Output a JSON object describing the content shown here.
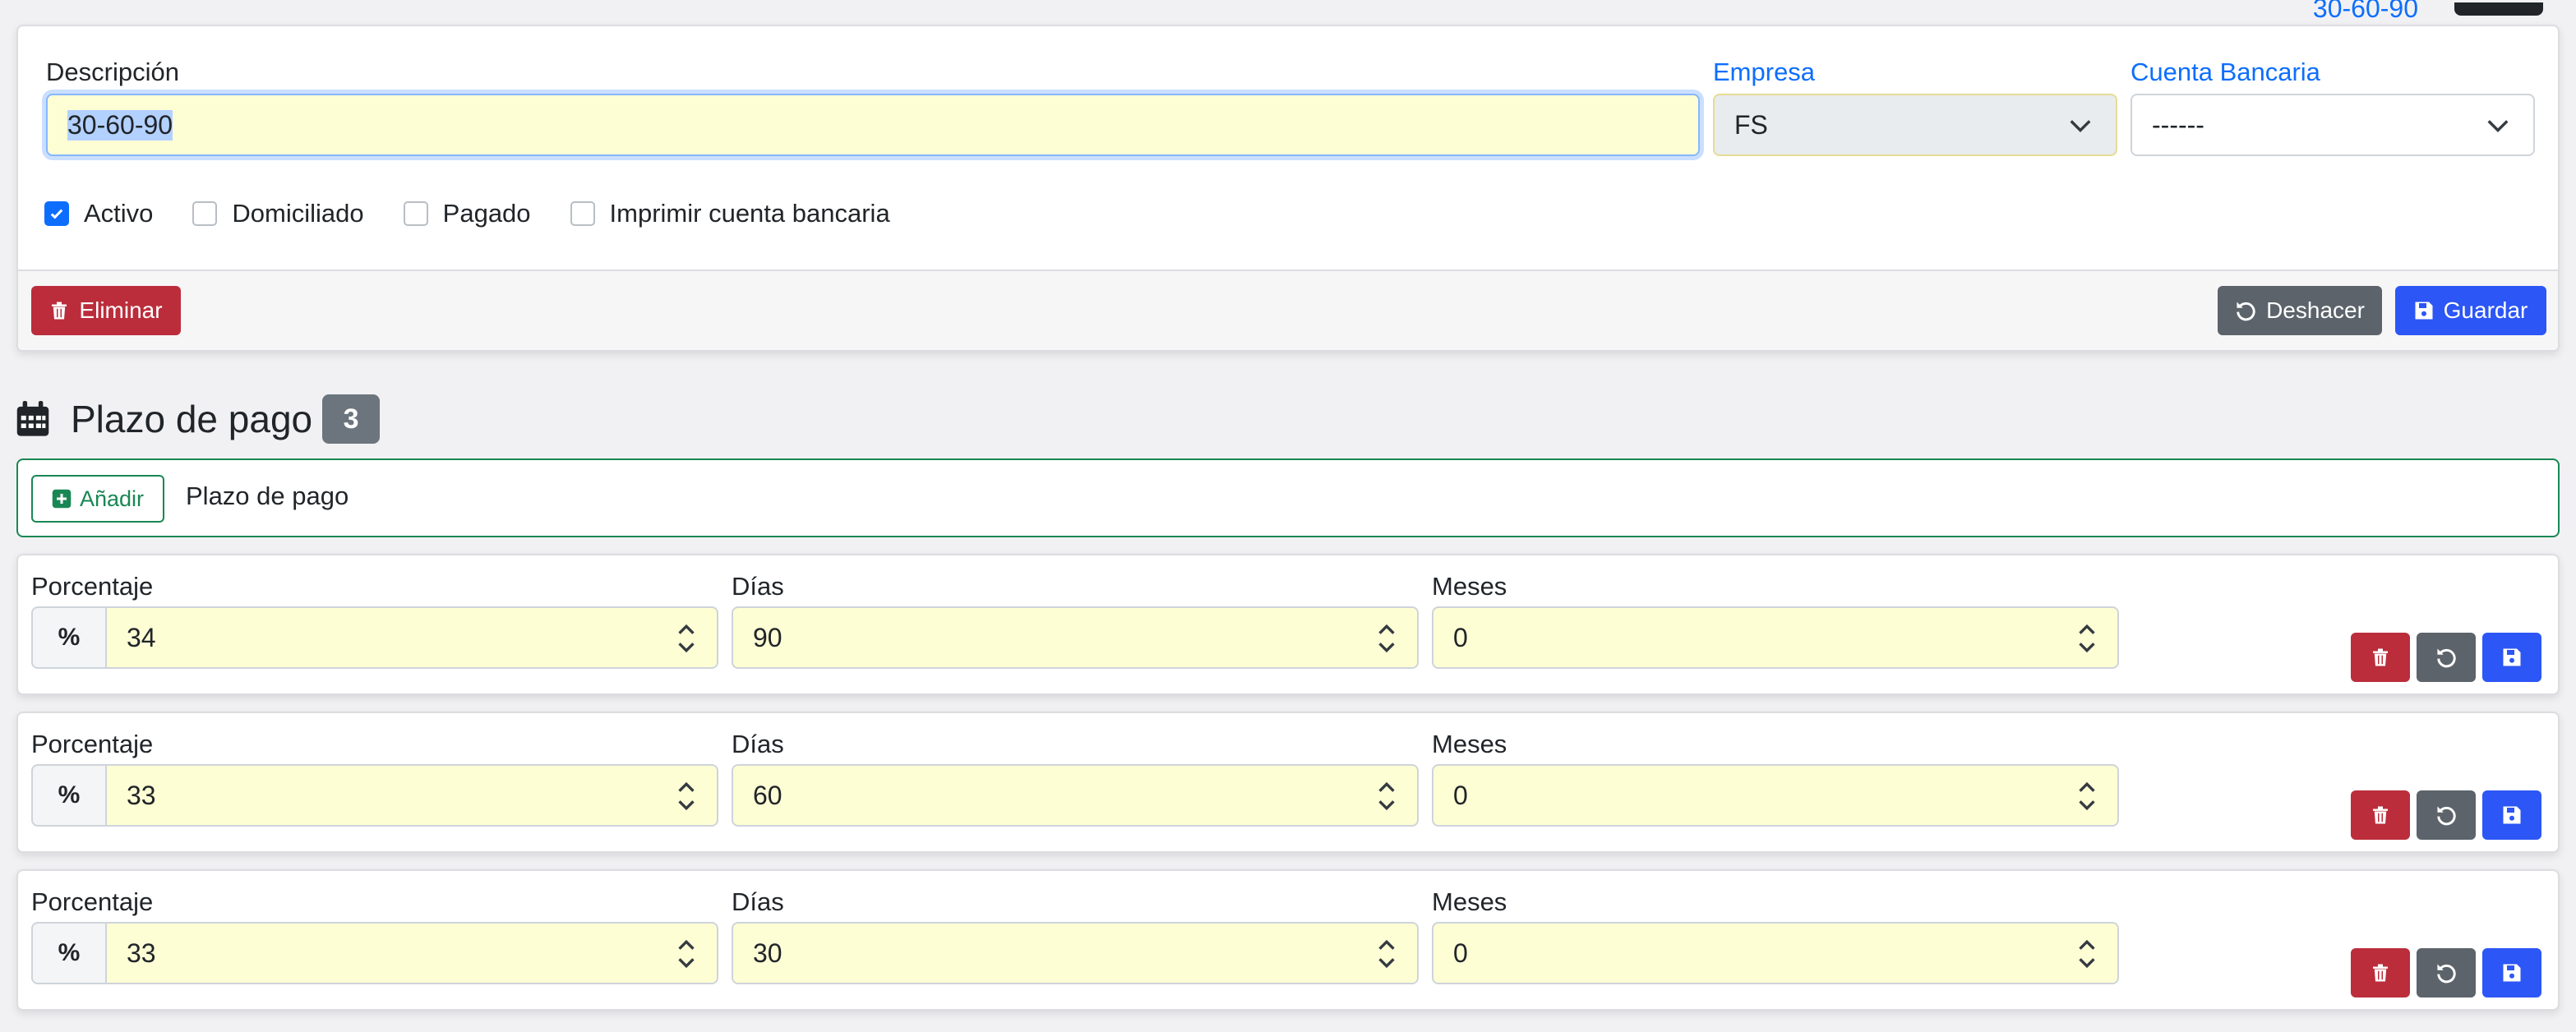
{
  "top_clip": {
    "link_text": "30-60-90"
  },
  "form": {
    "descripcion": {
      "label": "Descripción",
      "value": "30-60-90"
    },
    "empresa": {
      "label": "Empresa",
      "value": "FS"
    },
    "cuenta_bancaria": {
      "label": "Cuenta Bancaria",
      "value": "------"
    },
    "checkboxes": [
      {
        "label": "Activo",
        "checked": true
      },
      {
        "label": "Domiciliado",
        "checked": false
      },
      {
        "label": "Pagado",
        "checked": false
      },
      {
        "label": "Imprimir cuenta bancaria",
        "checked": false
      }
    ],
    "buttons": {
      "delete": "Eliminar",
      "undo": "Deshacer",
      "save": "Guardar"
    }
  },
  "section": {
    "title": "Plazo de pago",
    "count": "3",
    "add_button": "Añadir",
    "add_label": "Plazo de pago"
  },
  "field_labels": {
    "porcentaje": "Porcentaje",
    "dias": "Días",
    "meses": "Meses"
  },
  "percent_symbol": "%",
  "terms": [
    {
      "porcentaje": "34",
      "dias": "90",
      "meses": "0"
    },
    {
      "porcentaje": "33",
      "dias": "60",
      "meses": "0"
    },
    {
      "porcentaje": "33",
      "dias": "30",
      "meses": "0"
    }
  ],
  "icons": {
    "section": "calendar-icon",
    "delete": "trash-icon",
    "undo": "undo-icon",
    "save": "floppy-disk-icon",
    "add": "plus-square-icon",
    "select": "chevron-down-icon",
    "spinner": "spinner-arrows-icon"
  },
  "colors": {
    "primary": "#2c56f5",
    "danger": "#bb2d3b",
    "secondary": "#5c636a",
    "success": "#198754",
    "field_bg": "#fefed5",
    "label_link": "#0d6efd"
  }
}
